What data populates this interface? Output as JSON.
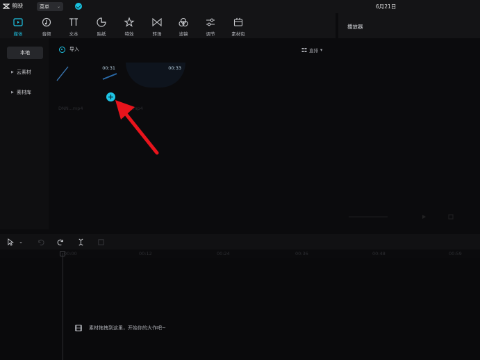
{
  "app": {
    "name": "剪映",
    "menu_label": "菜单",
    "date": "6月21日"
  },
  "toolbar": {
    "tabs": [
      {
        "label": "媒体",
        "icon": "media-icon",
        "active": true
      },
      {
        "label": "音频",
        "icon": "audio-icon"
      },
      {
        "label": "文本",
        "icon": "text-icon"
      },
      {
        "label": "贴纸",
        "icon": "sticker-icon"
      },
      {
        "label": "特效",
        "icon": "effects-icon"
      },
      {
        "label": "转场",
        "icon": "transition-icon"
      },
      {
        "label": "滤镜",
        "icon": "filter-icon"
      },
      {
        "label": "调节",
        "icon": "adjust-icon"
      },
      {
        "label": "素材包",
        "icon": "asset-pack-icon"
      }
    ],
    "accent_color": "#1ec5e6"
  },
  "player": {
    "title": "播放器"
  },
  "sidebar": {
    "items": [
      {
        "label": "本地",
        "active": true
      },
      {
        "label": "云素材"
      },
      {
        "label": "素材库"
      }
    ]
  },
  "media": {
    "import_label": "导入",
    "sort_label": "直排",
    "clips": [
      {
        "duration": "00:31",
        "name": "DNN...mp4"
      },
      {
        "duration": "00:33",
        "name": "...mp4"
      }
    ]
  },
  "timeline": {
    "ticks": [
      "00:00",
      "00:12",
      "00:24",
      "00:36",
      "00:48",
      "00:59"
    ],
    "drop_hint": "素材拖拽到这里，开始你的大作吧~"
  }
}
